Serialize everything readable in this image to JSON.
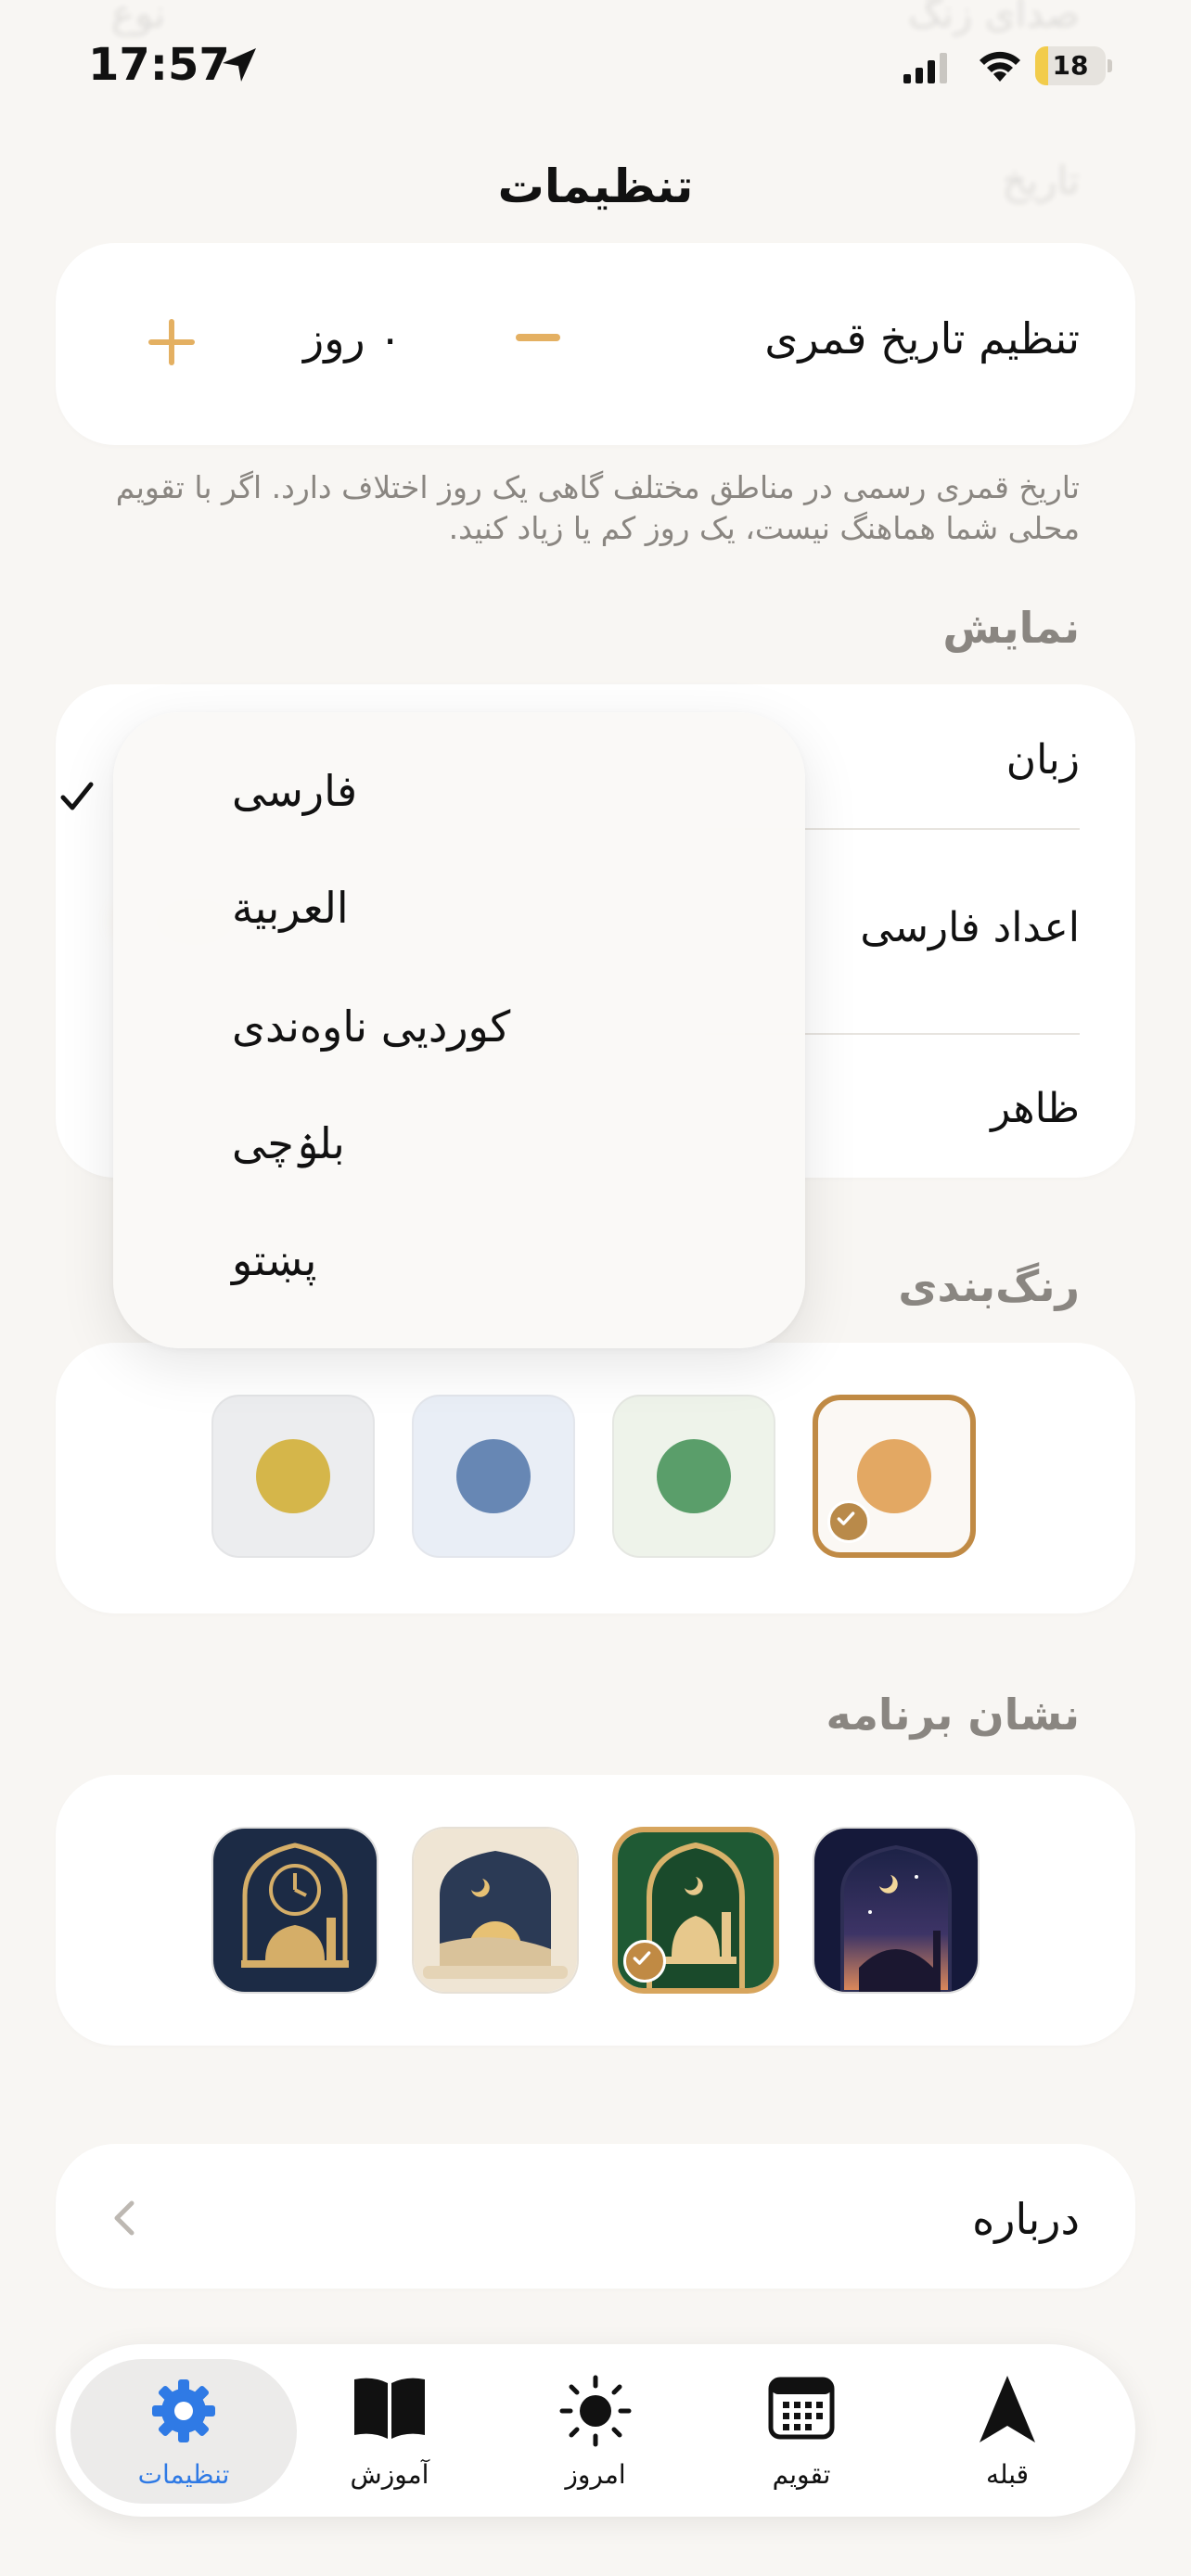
{
  "status_bar": {
    "time": "17:57",
    "battery": "18",
    "battery_level": 0.18
  },
  "ghost_text": {
    "row1_right": "صدای زنگ",
    "row1_left": "نوع",
    "row2_right": "تاریخ"
  },
  "page": {
    "title": "تنظیمات"
  },
  "hijri": {
    "label": "تنظیم تاریخ قمری",
    "value": "۰ روز",
    "minus": "−",
    "plus": "+"
  },
  "footnote": "تاریخ قمری رسمی در مناطق مختلف گاهی یک روز اختلاف دارد. اگر با تقویم محلی شما هماهنگ نیست، یک روز کم یا زیاد کنید.",
  "display": {
    "heading": "نمایش",
    "language_label": "زبان",
    "persian_digits_label": "اعداد فارسی",
    "appearance_label": "ظاهر"
  },
  "language_menu": {
    "selected_index": 0,
    "options": [
      "فارسی",
      "العربية",
      "كوردیی ناوەندی",
      "بلۏچی",
      "پښتو"
    ]
  },
  "color_theme": {
    "heading": "رنگ‌بندی",
    "swatches": [
      {
        "name": "orange",
        "dot": "#e3a863",
        "bg": "#fbf8f4",
        "selected": true
      },
      {
        "name": "green",
        "dot": "#5a9e6a",
        "bg": "#eef3ea",
        "selected": false
      },
      {
        "name": "blue",
        "dot": "#6787b4",
        "bg": "#e9eef6",
        "selected": false
      },
      {
        "name": "yellow",
        "dot": "#d5b64a",
        "bg": "#ecedef",
        "selected": false
      }
    ]
  },
  "app_icon": {
    "heading": "نشان برنامه",
    "icons": [
      {
        "name": "night-mosque-icon",
        "selected": false
      },
      {
        "name": "green-gold-mosque-icon",
        "selected": true
      },
      {
        "name": "sunrise-arch-icon",
        "selected": false
      },
      {
        "name": "clock-mosque-icon",
        "selected": false
      }
    ]
  },
  "about": {
    "label": "درباره"
  },
  "tab_bar": {
    "tabs": [
      {
        "id": "qibla",
        "label": "قبله",
        "icon": "compass-arrow-icon"
      },
      {
        "id": "calendar",
        "label": "تقویم",
        "icon": "calendar-icon"
      },
      {
        "id": "today",
        "label": "امروز",
        "icon": "sun-icon"
      },
      {
        "id": "learn",
        "label": "آموزش",
        "icon": "book-icon"
      },
      {
        "id": "settings",
        "label": "تنظیمات",
        "icon": "gear-icon",
        "active": true
      }
    ],
    "active_color": "#2f7ae5"
  },
  "colors": {
    "accent": "#e4b062",
    "selected_border": "#c08a44",
    "background": "#f8f6f3"
  }
}
